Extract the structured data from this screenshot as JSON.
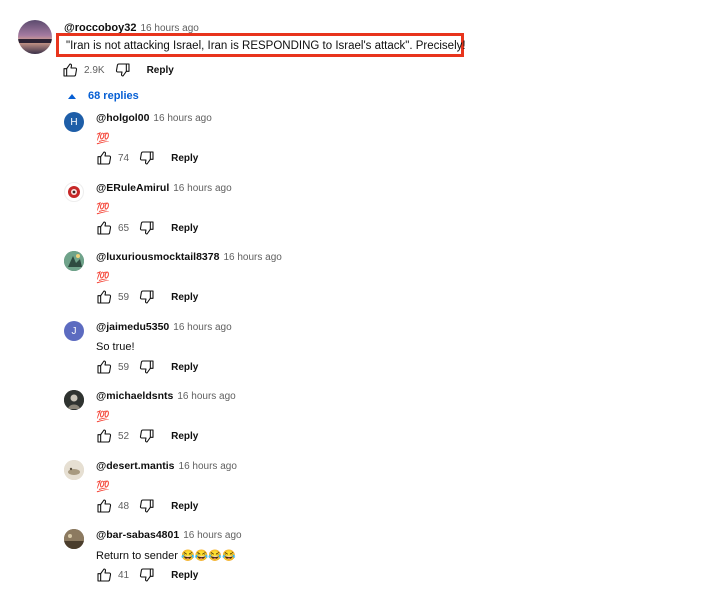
{
  "top_comment": {
    "handle": "@roccoboy32",
    "time": "16 hours ago",
    "text": "\"Iran is not attacking Israel, Iran is RESPONDING to Israel's attack\".  Precisely!",
    "likes": "2.9K",
    "reply_label": "Reply"
  },
  "replies_toggle": {
    "label": "68 replies"
  },
  "colors": {
    "highlight_border": "#e8341c",
    "link_blue": "#065fd4"
  },
  "replies": [
    {
      "handle": "@holgol00",
      "time": "16 hours ago",
      "text": "💯",
      "likes": "74",
      "reply_label": "Reply",
      "avatar_letter": "H",
      "avatar_color": "#1e5ea8"
    },
    {
      "handle": "@ERuleAmirul",
      "time": "16 hours ago",
      "text": "💯",
      "likes": "65",
      "reply_label": "Reply",
      "avatar_letter": "",
      "avatar_color": "#ffffff"
    },
    {
      "handle": "@luxuriousmocktail8378",
      "time": "16 hours ago",
      "text": "💯",
      "likes": "59",
      "reply_label": "Reply",
      "avatar_letter": "",
      "avatar_color": "#4a7a6a"
    },
    {
      "handle": "@jaimedu5350",
      "time": "16 hours ago",
      "text": "So true!",
      "likes": "59",
      "reply_label": "Reply",
      "avatar_letter": "J",
      "avatar_color": "#5c6bc0"
    },
    {
      "handle": "@michaeldsnts",
      "time": "16 hours ago",
      "text": "💯",
      "likes": "52",
      "reply_label": "Reply",
      "avatar_letter": "",
      "avatar_color": "#3b3f3c"
    },
    {
      "handle": "@desert.mantis",
      "time": "16 hours ago",
      "text": "💯",
      "likes": "48",
      "reply_label": "Reply",
      "avatar_letter": "",
      "avatar_color": "#d9d2c4"
    },
    {
      "handle": "@bar-sabas4801",
      "time": "16 hours ago",
      "text": "Return to sender 😂😂😂😂",
      "likes": "41",
      "reply_label": "Reply",
      "avatar_letter": "",
      "avatar_color": "#6b5a45"
    }
  ]
}
